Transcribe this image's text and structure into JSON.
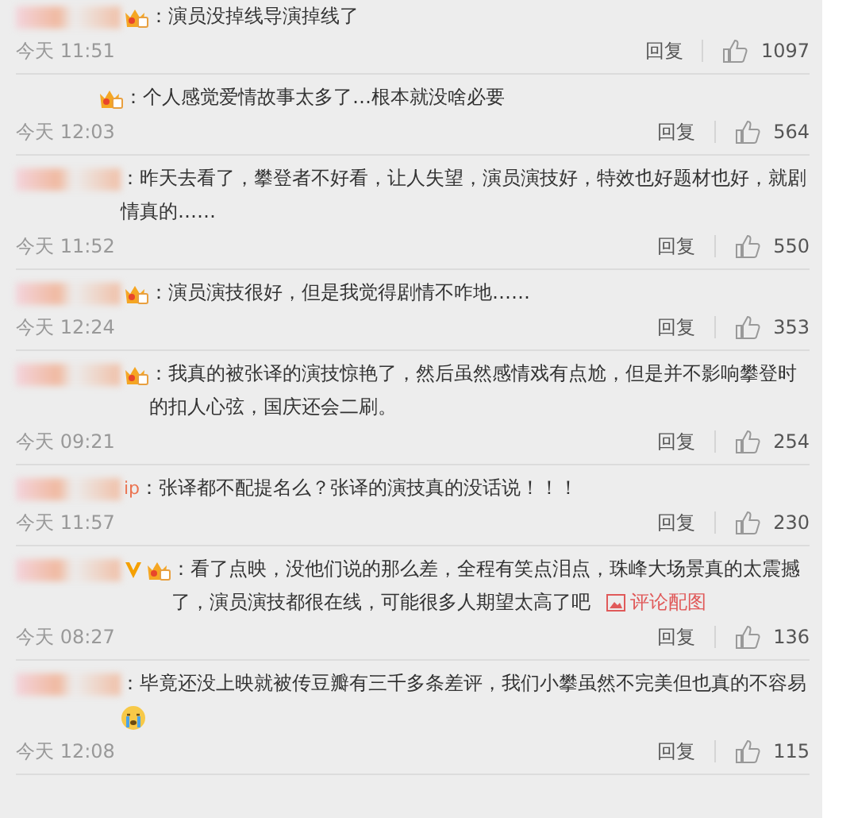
{
  "comments": [
    {
      "fan_badge": true,
      "text": "：演员没掉线导演掉线了",
      "time": "今天 11:51",
      "reply": "回复",
      "likes": "1097"
    },
    {
      "fan_badge": true,
      "indent": true,
      "text": "：个人感觉爱情故事太多了…根本就没啥必要",
      "time": "今天 12:03",
      "reply": "回复",
      "likes": "564"
    },
    {
      "text": "：昨天去看了，攀登者不好看，让人失望，演员演技好，特效也好题材也好，就剧情真的……",
      "time": "今天 11:52",
      "reply": "回复",
      "likes": "550"
    },
    {
      "fan_badge": true,
      "text": "：演员演技很好，但是我觉得剧情不咋地……",
      "time": "今天 12:24",
      "reply": "回复",
      "likes": "353"
    },
    {
      "fan_badge": true,
      "text": "：我真的被张译的演技惊艳了，然后虽然感情戏有点尬，但是并不影响攀登时的扣人心弦，国庆还会二刷。",
      "time": "今天 09:21",
      "reply": "回复",
      "likes": "254"
    },
    {
      "username": "ip",
      "text": "：张译都不配提名么？张译的演技真的没话说！！！",
      "time": "今天 11:57",
      "reply": "回复",
      "likes": "230"
    },
    {
      "verified": true,
      "fan_badge": true,
      "text": "：看了点映，没他们说的那么差，全程有笑点泪点，珠峰大场景真的太震撼了，演员演技都很在线，可能很多人期望太高了吧",
      "link": "评论配图",
      "time": "今天 08:27",
      "reply": "回复",
      "likes": "136"
    },
    {
      "text": "：毕竟还没上映就被传豆瓣有三千多条差评，我们小攀虽然不完美但也真的不容易",
      "trailing_emoji": true,
      "time": "今天 12:08",
      "reply": "回复",
      "likes": "115"
    }
  ]
}
